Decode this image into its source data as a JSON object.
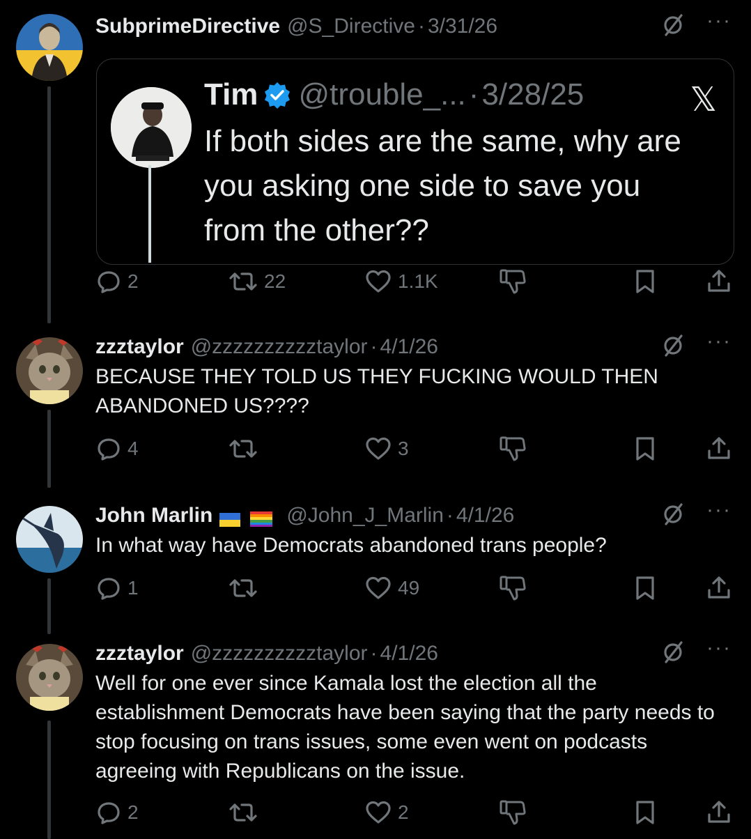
{
  "posts": [
    {
      "name": "SubprimeDirective",
      "handle": "@S_Directive",
      "sep": "·",
      "date": "3/31/26",
      "text": "",
      "replies": "2",
      "reposts": "22",
      "likes": "1.1K",
      "quote": {
        "name": "Tim",
        "handle": "@trouble_...",
        "sep": "·",
        "date": "3/28/25",
        "text": "If both sides are the same, why are you asking one side to save you from the other??",
        "logo": "𝕏"
      }
    },
    {
      "name": "zzztaylor",
      "handle": "@zzzzzzzzzztaylor",
      "sep": "·",
      "date": "4/1/26",
      "text": "BECAUSE THEY TOLD US THEY FUCKING WOULD THEN ABANDONED US????",
      "replies": "4",
      "reposts": "",
      "likes": "3"
    },
    {
      "name": "John Marlin",
      "handle": "@John_J_Marlin",
      "sep": "·",
      "date": "4/1/26",
      "text": "In what way have Democrats abandoned trans people?",
      "replies": "1",
      "reposts": "",
      "likes": "49"
    },
    {
      "name": "zzztaylor",
      "handle": "@zzzzzzzzzztaylor",
      "sep": "·",
      "date": "4/1/26",
      "text": "Well for one ever since Kamala lost the election all the establishment Democrats have been saying that the party needs to stop focusing on trans issues, some even went on podcasts agreeing with Republicans on the issue.",
      "replies": "2",
      "reposts": "",
      "likes": "2"
    }
  ],
  "icons": {
    "more": "···",
    "grok": "grok-icon",
    "reply": "reply-icon",
    "repost": "repost-icon",
    "like": "like-icon",
    "dislike": "dislike-icon",
    "bookmark": "bookmark-icon",
    "share": "share-icon",
    "verified": "verified-badge-icon"
  },
  "colors": {
    "background": "#000000",
    "text": "#e7e9ea",
    "muted": "#71767b",
    "verified": "#1d9bf0",
    "thread_line": "#333639"
  }
}
